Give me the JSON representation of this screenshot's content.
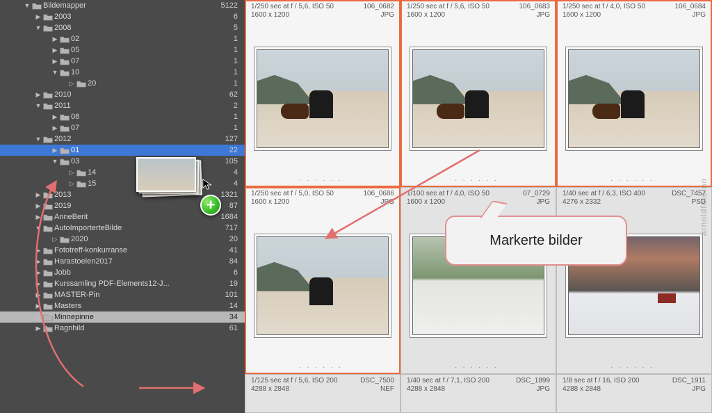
{
  "annotation": {
    "callout_text": "Markerte bilder"
  },
  "watermark": "arnoldfoto.no",
  "sidebar": {
    "items": [
      {
        "label": "Bildemapper",
        "count": "5122",
        "indent": 0,
        "arrow": "▼",
        "sel": false
      },
      {
        "label": "2003",
        "count": "6",
        "indent": 1,
        "arrow": "▶",
        "sel": false
      },
      {
        "label": "2008",
        "count": "5",
        "indent": 1,
        "arrow": "▼",
        "sel": false
      },
      {
        "label": "02",
        "count": "1",
        "indent": 2,
        "arrow": "▶",
        "sel": false
      },
      {
        "label": "05",
        "count": "1",
        "indent": 2,
        "arrow": "▶",
        "sel": false
      },
      {
        "label": "07",
        "count": "1",
        "indent": 2,
        "arrow": "▶",
        "sel": false
      },
      {
        "label": "10",
        "count": "1",
        "indent": 2,
        "arrow": "▼",
        "sel": false
      },
      {
        "label": "20",
        "count": "1",
        "indent": 3,
        "arrow": "▷",
        "sel": false
      },
      {
        "label": "2010",
        "count": "62",
        "indent": 1,
        "arrow": "▶",
        "sel": false
      },
      {
        "label": "2011",
        "count": "2",
        "indent": 1,
        "arrow": "▼",
        "sel": false
      },
      {
        "label": "06",
        "count": "1",
        "indent": 2,
        "arrow": "▶",
        "sel": false
      },
      {
        "label": "07",
        "count": "1",
        "indent": 2,
        "arrow": "▶",
        "sel": false
      },
      {
        "label": "2012",
        "count": "127",
        "indent": 1,
        "arrow": "▼",
        "sel": false
      },
      {
        "label": "01",
        "count": "22",
        "indent": 2,
        "arrow": "▶",
        "sel": true
      },
      {
        "label": "03",
        "count": "105",
        "indent": 2,
        "arrow": "▼",
        "sel": false
      },
      {
        "label": "14",
        "count": "4",
        "indent": 3,
        "arrow": "▷",
        "sel": false
      },
      {
        "label": "15",
        "count": "4",
        "indent": 3,
        "arrow": "▷",
        "sel": false
      },
      {
        "label": "2013",
        "count": "1321",
        "indent": 1,
        "arrow": "▶",
        "sel": false
      },
      {
        "label": "2019",
        "count": "87",
        "indent": 1,
        "arrow": "▶",
        "sel": false
      },
      {
        "label": "AnneBerit",
        "count": "1684",
        "indent": 1,
        "arrow": "▶",
        "sel": false
      },
      {
        "label": "AutoImporterteBilde",
        "count": "717",
        "indent": 1,
        "arrow": "▼",
        "sel": false
      },
      {
        "label": "2020",
        "count": "20",
        "indent": 2,
        "arrow": "▷",
        "sel": false
      },
      {
        "label": "Fototreff-konkurranse",
        "count": "41",
        "indent": 1,
        "arrow": "▶",
        "sel": false
      },
      {
        "label": "Harastoelen2017",
        "count": "84",
        "indent": 1,
        "arrow": "▶",
        "sel": false
      },
      {
        "label": "Jobb",
        "count": "6",
        "indent": 1,
        "arrow": "▶",
        "sel": false
      },
      {
        "label": "Kurssamling PDF-Elements12-J...",
        "count": "19",
        "indent": 1,
        "arrow": "▶",
        "sel": false
      },
      {
        "label": "MASTER-Pin",
        "count": "101",
        "indent": 1,
        "arrow": "▶",
        "sel": false
      },
      {
        "label": "Masters",
        "count": "14",
        "indent": 1,
        "arrow": "▶",
        "sel": false
      },
      {
        "label": "Minnepinne",
        "count": "34",
        "indent": 1,
        "arrow": "▶",
        "sel": false,
        "drop": true
      },
      {
        "label": "Ragnhild",
        "count": "61",
        "indent": 1,
        "arrow": "▶",
        "sel": false
      }
    ]
  },
  "grid": {
    "cells": [
      {
        "exp": "1/250 sec at f / 5,6, ISO 50",
        "name": "106_0682",
        "dim": "1600 x 1200",
        "fmt": "JPG",
        "sel": true,
        "style": "beach",
        "has_dog": true
      },
      {
        "exp": "1/250 sec at f / 5,6, ISO 50",
        "name": "106_0683",
        "dim": "1600 x 1200",
        "fmt": "JPG",
        "sel": true,
        "style": "beach",
        "has_dog": true
      },
      {
        "exp": "1/250 sec at f / 4,0, ISO 50",
        "name": "106_0684",
        "dim": "1600 x 1200",
        "fmt": "JPG",
        "sel": true,
        "style": "beach",
        "has_dog": true
      },
      {
        "exp": "1/250 sec at f / 5,0, ISO 50",
        "name": "106_0686",
        "dim": "1600 x 1200",
        "fmt": "JPG",
        "sel": true,
        "style": "beach",
        "has_dog": false
      },
      {
        "exp": "1/100 sec at f / 4,0, ISO 50",
        "name": "07_0729",
        "dim": "1600 x 1200",
        "fmt": "JPG",
        "sel": false,
        "style": "green",
        "has_dog": false
      },
      {
        "exp": "1/40 sec at f / 6,3, ISO 400",
        "name": "DSC_7457",
        "dim": "4276 x 2332",
        "fmt": "PSD",
        "sel": false,
        "style": "sunset",
        "has_dog": false
      },
      {
        "exp": "1/125 sec at f / 5,6, ISO 200",
        "name": "DSC_7500",
        "dim": "4288 x 2848",
        "fmt": "NEF",
        "sel": false,
        "style": "beach",
        "has_dog": false,
        "partial": true
      },
      {
        "exp": "1/40 sec at f / 7,1, ISO 200",
        "name": "DSC_1899",
        "dim": "4288 x 2848",
        "fmt": "JPG",
        "sel": false,
        "style": "green",
        "has_dog": false,
        "partial": true
      },
      {
        "exp": "1/8 sec at f / 16, ISO 200",
        "name": "DSC_1911",
        "dim": "4288 x 2848",
        "fmt": "JPG",
        "sel": false,
        "style": "sunset",
        "has_dog": false,
        "partial": true
      }
    ]
  }
}
